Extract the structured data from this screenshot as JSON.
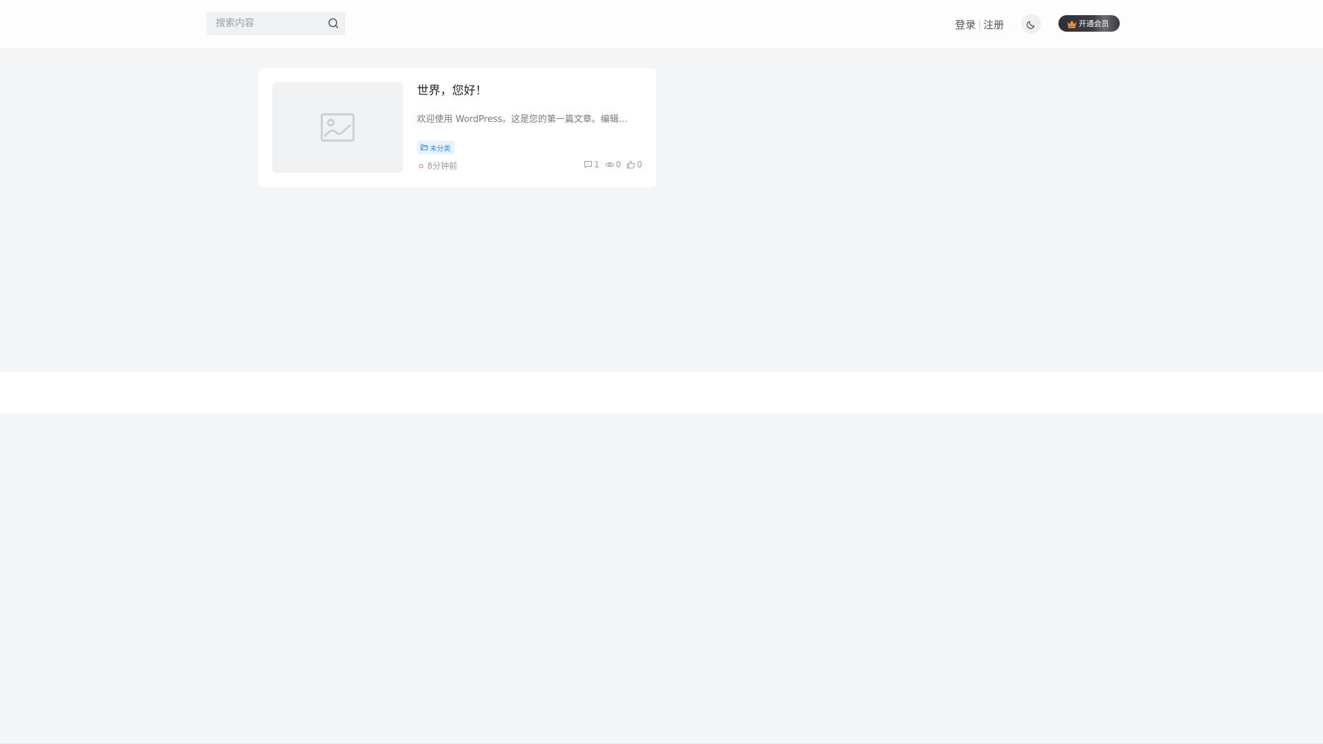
{
  "header": {
    "search": {
      "placeholder": "搜索内容",
      "value": ""
    },
    "login_label": "登录",
    "register_label": "注册",
    "theme_icon": "moon-icon",
    "vip_label": "开通会员",
    "vip_icon": "crown-icon"
  },
  "post": {
    "title": "世界，您好！",
    "excerpt": "欢迎使用 WordPress。这是您的第一篇文章。编辑…",
    "category": "未分类",
    "time": "8分钟前",
    "comments": "1",
    "views": "0",
    "likes": "0",
    "thumbnail_icon": "image-placeholder-icon"
  },
  "colors": {
    "page_bg": "#f4f5f7",
    "accent_blue": "#2f8fe0",
    "vip_bg": "#2f3033",
    "crown": "#f08a3c",
    "time_dot": "#f06292"
  }
}
